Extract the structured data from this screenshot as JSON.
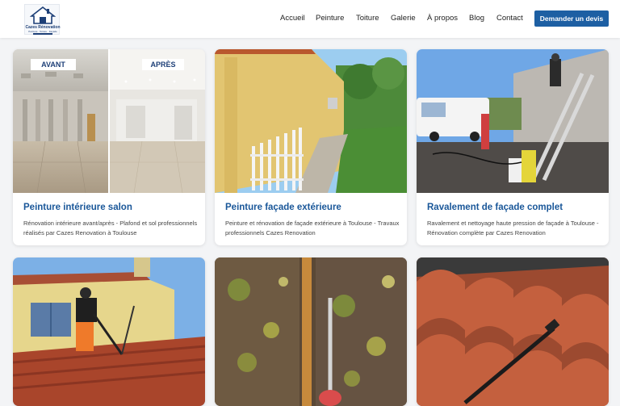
{
  "brand": {
    "name": "Cazes Rénovation",
    "tagline": "Peinture · Toiture · Façade"
  },
  "nav": [
    {
      "label": "Accueil"
    },
    {
      "label": "Peinture"
    },
    {
      "label": "Toiture"
    },
    {
      "label": "Galerie"
    },
    {
      "label": "À propos"
    },
    {
      "label": "Blog"
    },
    {
      "label": "Contact"
    }
  ],
  "cta": {
    "label": "Demander un devis"
  },
  "colors": {
    "primary": "#1d5fa3",
    "title": "#1a5799",
    "background": "#f3f4f6"
  },
  "gallery": [
    {
      "title": "Peinture intérieure salon",
      "description": "Rénovation intérieure avant/après - Plafond et sol professionnels réalisés par Cazes Renovation à Toulouse",
      "before_label": "AVANT",
      "after_label": "APRÈS"
    },
    {
      "title": "Peinture façade extérieure",
      "description": "Peinture et rénovation de façade extérieure à Toulouse - Travaux professionnels Cazes Renovation"
    },
    {
      "title": "Ravalement de façade complet",
      "description": "Ravalement et nettoyage haute pression de façade à Toulouse - Rénovation complète par Cazes Renovation"
    },
    {
      "image": "roof-pressure-washing-photo"
    },
    {
      "image": "mossy-tile-cleaning-photo"
    },
    {
      "image": "red-roof-tiles-cleaning-photo"
    }
  ]
}
